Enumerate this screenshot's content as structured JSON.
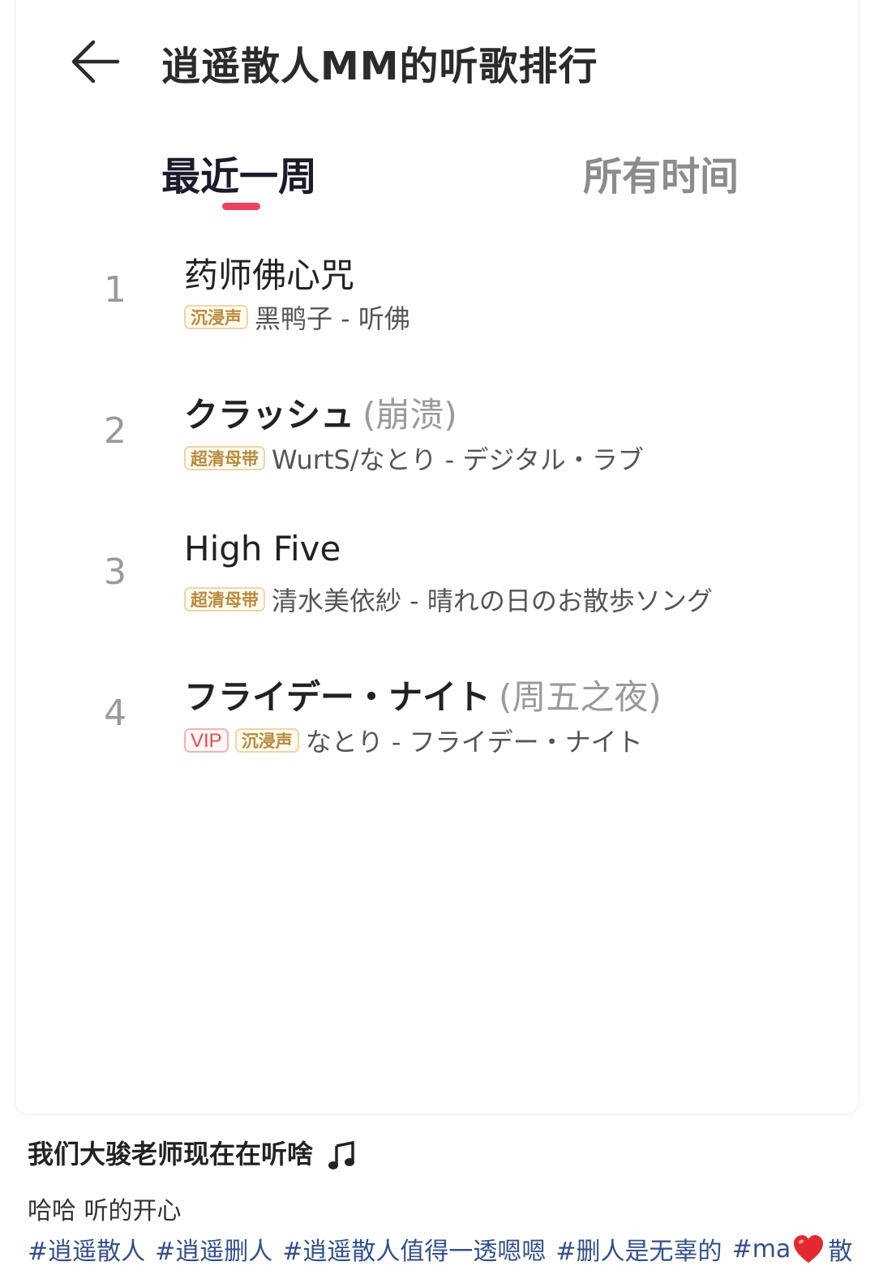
{
  "header": {
    "title": "逍遥散人MM的听歌排行"
  },
  "tabs": [
    {
      "label": "最近一周",
      "active": true
    },
    {
      "label": "所有时间",
      "active": false
    }
  ],
  "songs": [
    {
      "rank": "1",
      "title": "药师佛心咒",
      "subtitle": "",
      "badges": [
        "沉浸声"
      ],
      "artist_album": "黑鸭子 - 听佛"
    },
    {
      "rank": "2",
      "title": "クラッシュ",
      "subtitle": "(崩溃)",
      "badges": [
        "超清母带"
      ],
      "artist_album": "WurtS/なとり - デジタル・ラブ"
    },
    {
      "rank": "3",
      "title": "High Five",
      "subtitle": "",
      "badges": [
        "超清母带"
      ],
      "artist_album": "清水美依紗 - 晴れの日のお散歩ソング"
    },
    {
      "rank": "4",
      "title": "フライデー・ナイト",
      "subtitle": "(周五之夜)",
      "badges": [
        "VIP",
        "沉浸声"
      ],
      "artist_album": "なとり - フライデー・ナイト"
    }
  ],
  "post": {
    "caption": "我们大骏老师现在在听啥",
    "comment": "哈哈 听的开心",
    "tags": [
      "#逍遥散人",
      "#逍遥删人",
      "#逍遥散人值得一透嗯嗯",
      "#删人是无辜的",
      "#ma"
    ],
    "tag_tail": "散"
  },
  "colors": {
    "accent": "#ec4160",
    "badge_gold": "#b88a3a",
    "badge_vip": "#e94b4b",
    "tag_link": "#33508a"
  },
  "icons": {
    "back": "arrow-left-icon",
    "note": "music-note-icon",
    "heart": "heart-icon"
  }
}
